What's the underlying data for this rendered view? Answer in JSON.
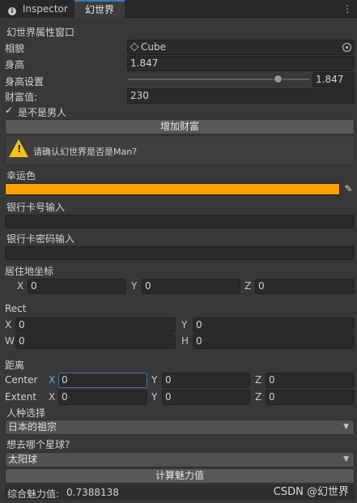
{
  "tabs": {
    "inspector": "Inspector",
    "active": "幻世界",
    "menu_icon": "kebab-menu-icon"
  },
  "window_title": "幻世界属性窗口",
  "appearance": {
    "label": "相貌",
    "value": "Cube",
    "icon": "cube-icon",
    "picker_icon": "object-picker-icon"
  },
  "height": {
    "label": "身高",
    "value": "1.847"
  },
  "height_setting": {
    "label": "身高设置",
    "value": "1.847",
    "slider_fraction": 0.83
  },
  "wealth": {
    "label": "财富值:",
    "value": "230"
  },
  "is_male": {
    "label": "是不是男人",
    "checked": true
  },
  "add_wealth_button": "增加财富",
  "help": {
    "icon": "warning-icon",
    "text": "请确认幻世界是否是Man?"
  },
  "lucky_color": {
    "label": "幸运色",
    "color": "#ffa000",
    "eyedropper_icon": "eyedropper-icon"
  },
  "bank_card": {
    "label": "银行卡号输入",
    "value": ""
  },
  "bank_password": {
    "label": "银行卡密码输入",
    "value": ""
  },
  "residence": {
    "label": "居住地坐标",
    "x_label": "X",
    "x": "0",
    "y_label": "Y",
    "y": "0",
    "z_label": "Z",
    "z": "0"
  },
  "rect": {
    "label": "Rect",
    "x_label": "X",
    "x": "0",
    "y_label": "Y",
    "y": "0",
    "w_label": "W",
    "w": "0",
    "h_label": "H",
    "h": "0"
  },
  "distance": {
    "label": "距离",
    "center": {
      "label": "Center",
      "x_label": "X",
      "x": "0",
      "y_label": "Y",
      "y": "0",
      "z_label": "Z",
      "z": "0"
    },
    "extent": {
      "label": "Extent",
      "x_label": "X",
      "x": "0",
      "y_label": "Y",
      "y": "0",
      "z_label": "Z",
      "z": "0"
    }
  },
  "race": {
    "label": "人种选择",
    "value": "日本的祖宗"
  },
  "planet": {
    "label": "想去哪个星球?",
    "value": "太阳球"
  },
  "calc_button": "计算魅力值",
  "charm": {
    "label": "综合魅力值:",
    "value": "0.7388138"
  },
  "watermark": "CSDN @幻世界"
}
